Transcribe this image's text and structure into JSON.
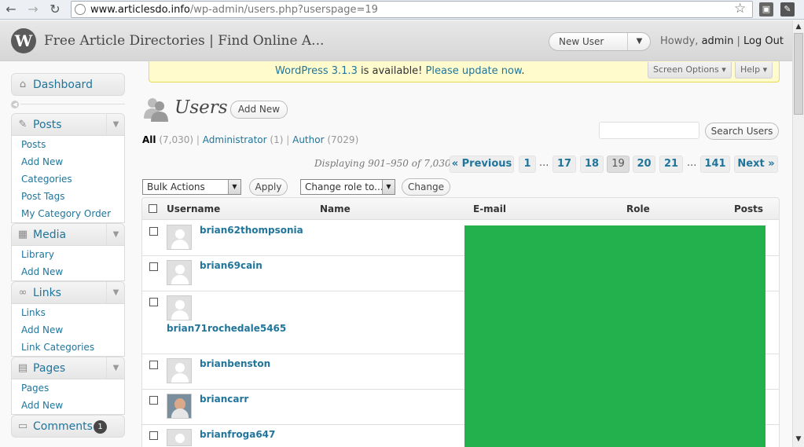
{
  "browser": {
    "url_host": "www.articlesdo.info",
    "url_path": "/wp-admin/users.php?userspage=19"
  },
  "header": {
    "logo_letter": "W",
    "site_title": "Free Article Directories | Find Online A...",
    "favorite_action": "New User",
    "howdy_prefix": "Howdy,",
    "user": "admin",
    "logout": "Log Out"
  },
  "nag": {
    "version_link": "WordPress 3.1.3",
    "middle": "is available!",
    "update_link": "Please update now",
    "end": "."
  },
  "screen_options": "Screen Options",
  "help": "Help",
  "sidebar": {
    "dashboard": "Dashboard",
    "posts": {
      "label": "Posts",
      "items": [
        "Posts",
        "Add New",
        "Categories",
        "Post Tags",
        "My Category Order"
      ]
    },
    "media": {
      "label": "Media",
      "items": [
        "Library",
        "Add New"
      ]
    },
    "links": {
      "label": "Links",
      "items": [
        "Links",
        "Add New",
        "Link Categories"
      ]
    },
    "pages": {
      "label": "Pages",
      "items": [
        "Pages",
        "Add New"
      ]
    },
    "comments": {
      "label": "Comments",
      "badge": "1"
    }
  },
  "page": {
    "title": "Users",
    "add_new": "Add New",
    "search_button": "Search Users",
    "filters": {
      "all": "All",
      "all_count": "(7,030)",
      "admin": "Administrator",
      "admin_count": "(1)",
      "author": "Author",
      "author_count": "(7029)",
      "sep": "|"
    },
    "displaying": "Displaying 901–950 of 7,030",
    "pagination": {
      "prev": "« Previous",
      "p1": "1",
      "dots": "...",
      "p17": "17",
      "p18": "18",
      "p19": "19",
      "p20": "20",
      "p21": "21",
      "p141": "141",
      "next": "Next »"
    },
    "bulk_actions": "Bulk Actions",
    "apply": "Apply",
    "change_role": "Change role to...",
    "change": "Change"
  },
  "table": {
    "headers": {
      "username": "Username",
      "name": "Name",
      "email": "E-mail",
      "role": "Role",
      "posts": "Posts"
    },
    "rows": [
      {
        "username": "brian62thompsonia"
      },
      {
        "username": "brian69cain"
      },
      {
        "username": "brian71rochedale5465"
      },
      {
        "username": "brianbenston"
      },
      {
        "username": "briancarr"
      },
      {
        "username": "brianfroga647"
      }
    ]
  },
  "colors": {
    "link": "#21759b",
    "redaction": "#22b14c",
    "nag_bg": "#fffbcc"
  }
}
